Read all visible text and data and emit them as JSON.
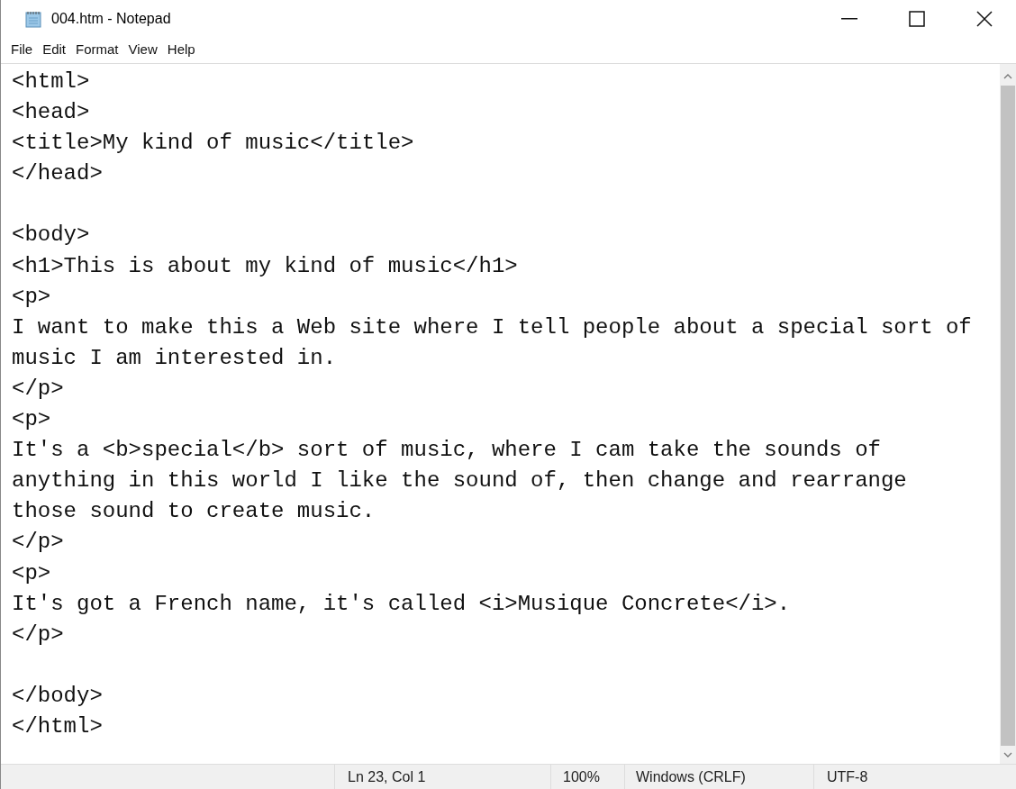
{
  "window": {
    "title": "004.htm - Notepad"
  },
  "menu": [
    "File",
    "Edit",
    "Format",
    "View",
    "Help"
  ],
  "editor": {
    "text": "<html>\n<head>\n<title>My kind of music</title>\n</head>\n\n<body>\n<h1>This is about my kind of music</h1>\n<p>\nI want to make this a Web site where I tell people about a special sort of\nmusic I am interested in.\n</p>\n<p>\nIt's a <b>special</b> sort of music, where I cam take the sounds of\nanything in this world I like the sound of, then change and rearrange\nthose sound to create music.\n</p>\n<p>\nIt's got a French name, it's called <i>Musique Concrete</i>.\n</p>\n\n</body>\n</html>"
  },
  "status_bar": {
    "position": "Ln 23, Col 1",
    "zoom": "100%",
    "line_ending": "Windows (CRLF)",
    "encoding": "UTF-8"
  }
}
